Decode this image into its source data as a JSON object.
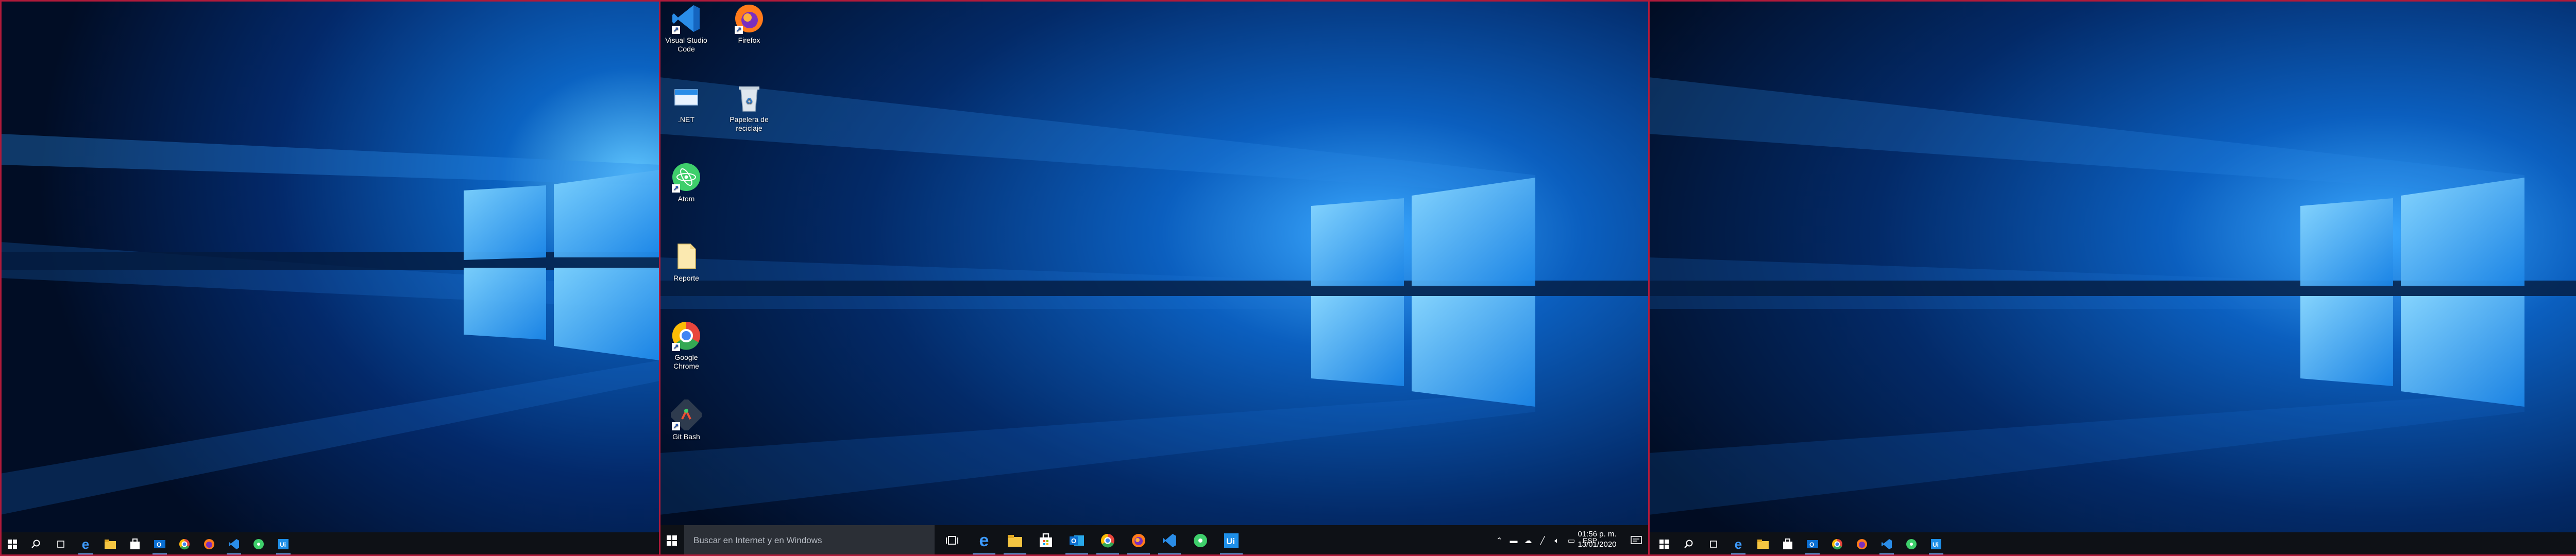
{
  "desktop": {
    "icons": [
      {
        "label": "Visual Studio Code",
        "icon": "vscode-icon"
      },
      {
        "label": "Firefox",
        "icon": "firefox-icon"
      },
      {
        "label": ".NET",
        "icon": "dotnet-icon"
      },
      {
        "label": "Papelera de reciclaje",
        "icon": "recycle-bin-icon"
      },
      {
        "label": "Atom",
        "icon": "atom-icon"
      },
      {
        "label": "Reporte",
        "icon": "document-icon"
      },
      {
        "label": "Google Chrome",
        "icon": "chrome-icon"
      },
      {
        "label": "Git Bash",
        "icon": "git-bash-icon"
      }
    ]
  },
  "taskbar": {
    "search_placeholder": "Buscar en Internet y en Windows",
    "pinned_apps": [
      "task-view",
      "edge",
      "file-explorer",
      "store",
      "outlook",
      "chrome",
      "firefox",
      "vscode",
      "atom",
      "uipath"
    ],
    "tray": {
      "language": "ESP",
      "time": "01:56 p. m.",
      "date": "13/01/2020"
    }
  },
  "colors": {
    "taskbar_bg": "#0e1116",
    "accent": "#6ab0ff",
    "frame": "#b01a3a",
    "wallpaper_base": "#021a3f"
  }
}
